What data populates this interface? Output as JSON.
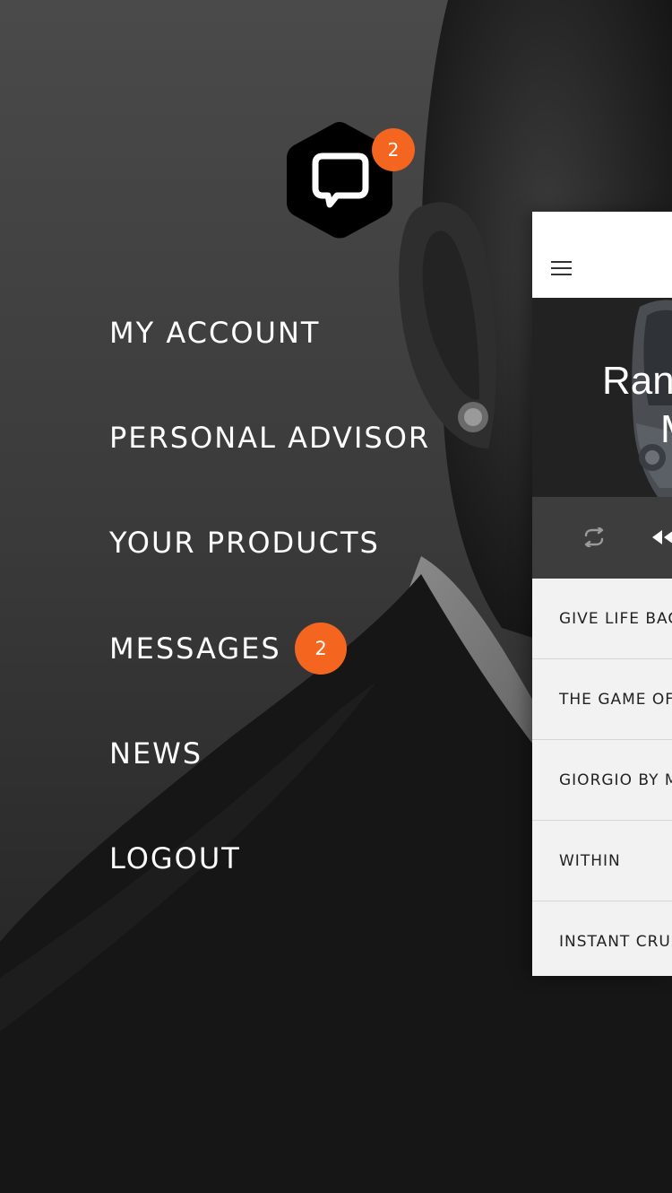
{
  "colors": {
    "accent": "#f4661f",
    "panel_background": "#f2f2f2",
    "controls_background": "#3d3d3d",
    "hero_background": "#222222",
    "menu_text": "#ffffff"
  },
  "logo": {
    "icon": "chat-bubble-hexagon-icon",
    "badge_count": "2"
  },
  "menu": {
    "items": [
      {
        "label": "MY ACCOUNT"
      },
      {
        "label": "PERSONAL ADVISOR"
      },
      {
        "label": "YOUR PRODUCTS"
      },
      {
        "label": "MESSAGES",
        "badge": "2"
      },
      {
        "label": "NEWS"
      },
      {
        "label": "LOGOUT"
      }
    ]
  },
  "panel": {
    "menu_icon": "hamburger-icon",
    "hero": {
      "title": "Ran",
      "subtitle": "M"
    },
    "controls": {
      "repeat_icon": "repeat-icon",
      "rewind_icon": "rewind-icon"
    },
    "tracks": [
      {
        "title": "GIVE LIFE BAC"
      },
      {
        "title": "THE GAME OF"
      },
      {
        "title": "GIORGIO BY M"
      },
      {
        "title": "WITHIN"
      },
      {
        "title": "INSTANT CRU"
      }
    ]
  }
}
